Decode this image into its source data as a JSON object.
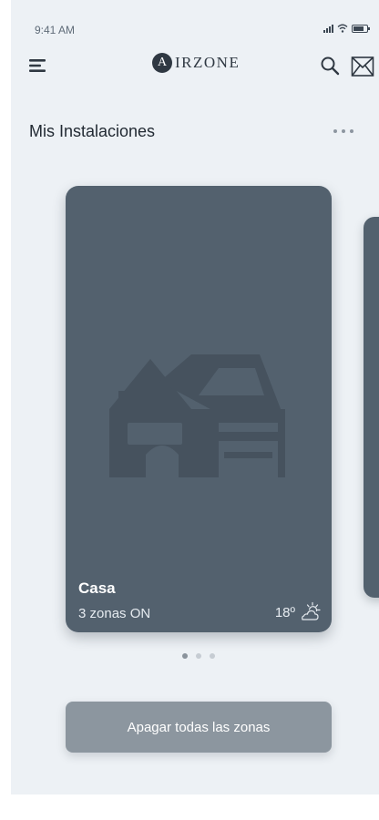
{
  "status_bar": {
    "time": "9:41 AM",
    "icons": [
      "signal-icon",
      "wifi-icon",
      "battery-icon"
    ]
  },
  "header": {
    "menu_icon": "hamburger-menu-icon",
    "logo_mark": "A",
    "logo_text": "IRZONE",
    "search_icon": "search-icon",
    "mail_icon": "mail-icon"
  },
  "section": {
    "title": "Mis Instalaciones",
    "more_icon": "more-options-icon"
  },
  "installation_card": {
    "name": "Casa",
    "zones": "3 zonas ON",
    "temperature": "18º",
    "illustration_icon": "house-icon",
    "weather_icon": "partly-cloudy-icon",
    "background_color": "#53616e"
  },
  "pager": {
    "count": 3,
    "active_index": 0
  },
  "actions": {
    "turn_off_all_label": "Apagar todas las zonas"
  },
  "colors": {
    "background": "#edf1f5",
    "card": "#53616e",
    "button": "#8c969f",
    "text_dark": "#222a33"
  }
}
